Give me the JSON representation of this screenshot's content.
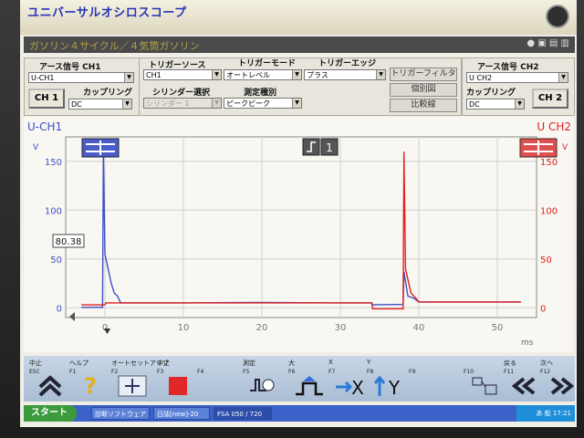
{
  "app": {
    "title": "ユニバーサルオシロスコープ"
  },
  "subheader": {
    "text": "ガソリン４サイクル／４気筒ガソリン"
  },
  "ch1_panel": {
    "signal_label": "アース信号 CH1",
    "signal_value": "U-CH1",
    "ch_button": "CH 1",
    "coupling_label": "カップリング",
    "coupling_value": "DC"
  },
  "trigger": {
    "source_label": "トリガーソース",
    "source_value": "CH1",
    "mode_label": "トリガーモード",
    "mode_value": "オートレベル",
    "edge_label": "トリガーエッジ",
    "edge_value": "プラス",
    "cylinder_label": "シリンダー選択",
    "cylinder_value": "シリンダー 1",
    "measure_label": "測定種別",
    "measure_value": "ピークピーク",
    "filter_button": "トリガーフィルター",
    "individual_button": "個別図",
    "compare_button": "比較線"
  },
  "ch2_panel": {
    "signal_label": "アース信号 CH2",
    "signal_value": "U CH2",
    "ch_button": "CH 2",
    "coupling_label": "カップリング",
    "coupling_value": "DC"
  },
  "plot": {
    "ch1_title": "U-CH1",
    "ch2_title": "U CH2",
    "ch1_unit": "V",
    "ch2_unit": "V",
    "x_unit": "ms",
    "cursor_value": "80.38",
    "trigger_badge": "1",
    "ch1_color": "#3d4fc8",
    "ch2_color": "#e02020"
  },
  "chart_data": {
    "type": "line",
    "xlabel": "ms",
    "ylabel": "V",
    "xlim": [
      0,
      50
    ],
    "x_ticks": [
      "0",
      "10",
      "20",
      "30",
      "40",
      "50"
    ],
    "y_left_ticks": [
      "0",
      "50",
      "100",
      "150"
    ],
    "y_right_ticks": [
      "0",
      "50",
      "100",
      "150"
    ],
    "ylim": [
      -10,
      175
    ],
    "grid": true,
    "series": [
      {
        "name": "U-CH1",
        "color": "#3d4fc8",
        "axis": "left",
        "points": [
          [
            -3,
            0.5
          ],
          [
            -0.3,
            0.5
          ],
          [
            -0.2,
            160
          ],
          [
            0,
            55
          ],
          [
            0.8,
            25
          ],
          [
            1.2,
            15
          ],
          [
            1.6,
            12
          ],
          [
            2,
            5
          ],
          [
            10,
            5
          ],
          [
            20,
            5.5
          ],
          [
            30,
            5
          ],
          [
            34,
            5
          ],
          [
            34.1,
            3
          ],
          [
            38,
            3.5
          ],
          [
            38.1,
            37
          ],
          [
            38.6,
            12
          ],
          [
            39.3,
            10
          ],
          [
            40,
            6
          ],
          [
            50,
            6
          ],
          [
            53,
            6
          ]
        ]
      },
      {
        "name": "U CH2",
        "color": "#e02020",
        "axis": "right",
        "points": [
          [
            -3,
            3
          ],
          [
            0,
            3
          ],
          [
            0.1,
            5
          ],
          [
            10,
            5
          ],
          [
            20,
            5
          ],
          [
            30,
            5
          ],
          [
            34,
            5
          ],
          [
            34.1,
            -1
          ],
          [
            38,
            -1
          ],
          [
            38.1,
            160
          ],
          [
            38.3,
            40
          ],
          [
            39,
            15
          ],
          [
            39.6,
            10
          ],
          [
            40,
            6
          ],
          [
            50,
            6
          ],
          [
            53,
            6
          ]
        ]
      }
    ]
  },
  "fkeys": [
    {
      "label": "中止",
      "code": "ESC",
      "icon": "double-up-arrow-icon"
    },
    {
      "label": "ヘルプ",
      "code": "F1",
      "icon": "question-icon"
    },
    {
      "label": "オートセットアップ",
      "code": "F2",
      "icon": "auto-setup-icon"
    },
    {
      "label": "中止",
      "code": "F3",
      "icon": "stop-icon"
    },
    {
      "label": "",
      "code": "F4",
      "icon": ""
    },
    {
      "label": "測定",
      "code": "F5",
      "icon": "measure-icon"
    },
    {
      "label": "大",
      "code": "F6",
      "icon": "trigger-pulse-icon"
    },
    {
      "label": "X",
      "code": "F7",
      "icon": "x-arrow-icon"
    },
    {
      "label": "Y",
      "code": "F8",
      "icon": "y-arrow-icon"
    },
    {
      "label": "",
      "code": "F9",
      "icon": ""
    },
    {
      "label": "",
      "code": "F10",
      "icon": "layout-icon"
    },
    {
      "label": "戻る",
      "code": "F11",
      "icon": "back-icon"
    },
    {
      "label": "次へ",
      "code": "F12",
      "icon": "next-icon"
    }
  ],
  "fkey_glyphs": {
    "x": "X",
    "y": "Y",
    "question": "?"
  },
  "taskbar": {
    "start": "スタート",
    "tasks": [
      "診断ソフトウェア",
      "日誌[new]-20",
      "FSA 050 / 720"
    ],
    "tray_text": "あ 般 17:21"
  }
}
